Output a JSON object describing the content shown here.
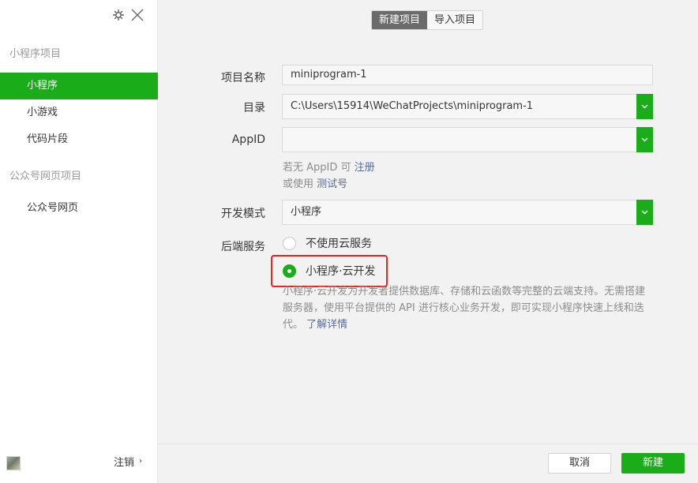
{
  "sidebar": {
    "section_miniprogram": "小程序项目",
    "items_mp": [
      {
        "label": "小程序",
        "active": true
      },
      {
        "label": "小游戏",
        "active": false
      },
      {
        "label": "代码片段",
        "active": false
      }
    ],
    "section_official": "公众号网页项目",
    "items_official": [
      {
        "label": "公众号网页",
        "active": false
      }
    ],
    "logout_label": "注销",
    "logout_arrow": "›"
  },
  "tabs": {
    "new_project": "新建项目",
    "import_project": "导入项目"
  },
  "form": {
    "name_label": "项目名称",
    "name_value": "miniprogram-1",
    "dir_label": "目录",
    "dir_value": "C:\\Users\\15914\\WeChatProjects\\miniprogram-1",
    "appid_label": "AppID",
    "appid_value": "",
    "appid_hint1_prefix": "若无 AppID 可 ",
    "appid_hint1_link": "注册",
    "appid_hint2_prefix": "或使用 ",
    "appid_hint2_link": "测试号",
    "mode_label": "开发模式",
    "mode_value": "小程序",
    "backend_label": "后端服务",
    "radio_no_cloud": "不使用云服务",
    "radio_cloud": "小程序·云开发",
    "cloud_desc": "小程序·云开发为开发者提供数据库、存储和云函数等完整的云端支持。无需搭建服务器，使用平台提供的 API 进行核心业务开发，即可实现小程序快速上线和迭代。",
    "learn_more": "了解详情"
  },
  "buttons": {
    "cancel": "取消",
    "create": "新建"
  },
  "colors": {
    "accent": "#1aad19",
    "link": "#576b95",
    "highlight": "#e5271f"
  }
}
